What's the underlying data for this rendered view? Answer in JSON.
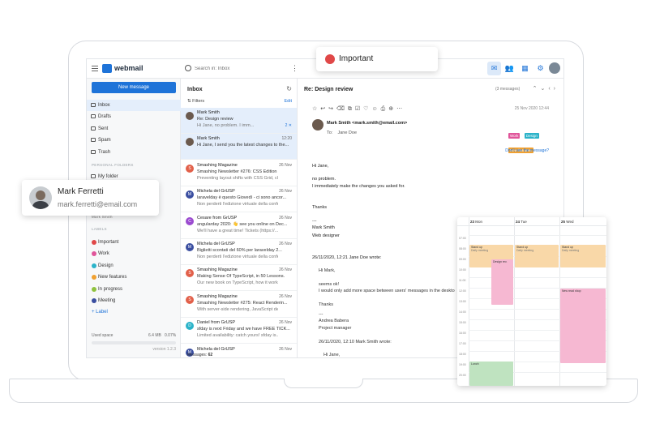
{
  "popups": {
    "important_label": "Important",
    "contact": {
      "first": "Mark",
      "last": "Ferretti",
      "email": "mark.ferretti@email.com"
    }
  },
  "app": {
    "logo": "webmail",
    "search_placeholder": "Search in: Inbox"
  },
  "sidebar": {
    "new_message": "New message",
    "folders": [
      "Inbox",
      "Drafts",
      "Sent",
      "Spam",
      "Trash"
    ],
    "personal_head": "PERSONAL FOLDERS",
    "my_folder": "My folder",
    "contact_sub": "Mark Smith",
    "labels_head": "LABELS",
    "labels": [
      {
        "name": "Important",
        "color": "#e04848"
      },
      {
        "name": "Work",
        "color": "#e0559a"
      },
      {
        "name": "Design",
        "color": "#2bb3c9"
      },
      {
        "name": "New features",
        "color": "#f0a030"
      },
      {
        "name": "In progress",
        "color": "#8fc23e"
      },
      {
        "name": "Meeting",
        "color": "#3a4ea0"
      }
    ],
    "add_label": "+ Label",
    "used_space": "Used space",
    "used_value": "6.4 MB",
    "used_pct": "0.07%",
    "version": "version 1.2.3"
  },
  "list": {
    "title": "Inbox",
    "filters": "Filters",
    "edit": "Edit",
    "footer_label": "Messages:",
    "footer_count": "62",
    "messages": [
      {
        "from": "Mark Smith",
        "date": "",
        "subject": "Re: Design review",
        "preview": "Hi Jane, no problem. I imm...",
        "flag": "2 ✕",
        "av": "#6b5a4e",
        "initial": "",
        "selected": true
      },
      {
        "from": "Mark Smith",
        "date": "12:20",
        "subject": "Hi Jane, I send you the latest changes to the...",
        "preview": "",
        "flag": "",
        "av": "#6b5a4e",
        "initial": "",
        "selected": true
      },
      {
        "from": "Smashing Magazine",
        "date": "26 Nov",
        "subject": "Smashing Newsletter #276: CSS Edition",
        "preview": "Preventing layout shifts with CSS Grid, cla...",
        "flag": "",
        "av": "#e2604a",
        "initial": "S",
        "selected": false
      },
      {
        "from": "Michela del GrUSP",
        "date": "26 Nov",
        "subject": "laravelday è questo Giovedì - ci sono ancor...",
        "preview": "Non perderti l'edizione virtuale della confe...",
        "flag": "",
        "av": "#3a4ea0",
        "initial": "M",
        "selected": false
      },
      {
        "from": "Cesare from GrUSP",
        "date": "26 Nov",
        "subject": "angularday 2020: 👋 see you online on Dec...",
        "preview": "We'll have a great time! Tickets (https://...",
        "flag": "",
        "av": "#9b4bd0",
        "initial": "C",
        "selected": false
      },
      {
        "from": "Michela del GrUSP",
        "date": "26 Nov",
        "subject": "Biglietti scontati del 60% per laravelday 2...",
        "preview": "Non perderti l'edizione virtuale della confe...",
        "flag": "",
        "av": "#3a4ea0",
        "initial": "M",
        "selected": false
      },
      {
        "from": "Smashing Magazine",
        "date": "26 Nov",
        "subject": "Making Sense Of TypeScript, in 50 Lessons.",
        "preview": "Our new book on TypeScript, how it works...",
        "flag": "",
        "av": "#e2604a",
        "initial": "S",
        "selected": false
      },
      {
        "from": "Smashing Magazine",
        "date": "26 Nov",
        "subject": "Smashing Newsletter #275: React Renderin...",
        "preview": "With server-side rendering, JavaScript deb...",
        "flag": "",
        "av": "#e2604a",
        "initial": "S",
        "selected": false
      },
      {
        "from": "Daniel from GrUSP",
        "date": "26 Nov",
        "subject": "sfday is next Friday and we have FREE TICK...",
        "preview": "Limited availability: catch yours! sfday is...",
        "flag": "",
        "av": "#2bb3c9",
        "initial": "D",
        "selected": false
      },
      {
        "from": "Michela del GrUSP",
        "date": "26 Nov",
        "subject": "",
        "preview": "",
        "flag": "",
        "av": "#3a4ea0",
        "initial": "M",
        "selected": false
      }
    ]
  },
  "reading": {
    "title": "Re: Design review",
    "count": "(3 messages)",
    "date": "25 Nov 2020 12:44",
    "sender": "Mark Smith <mark.smith@email.com>",
    "to_label": "To:",
    "to": "Jane Doe",
    "chips": [
      {
        "name": "Work",
        "color": "#e0559a"
      },
      {
        "name": "Design",
        "color": "#2bb3c9"
      },
      {
        "name": "New features",
        "color": "#f0a030"
      }
    ],
    "dont_see": "Don't see the message?",
    "body": [
      "Hi Jane,",
      "no problem.",
      "I immediately make the changes you asked for.",
      "Thanks",
      "---",
      "Mark Smith",
      "Web designer"
    ],
    "quote1_head": "26/11/2020, 12:21 Jane Doe wrote:",
    "quote1": [
      "Hi Mark,",
      "seems ok!",
      "I would only add more space between users' messages in the deskto",
      "Thanks",
      "---",
      "Andrea Babera",
      "Project manager"
    ],
    "quote2_head": "26/11/2020, 12:10 Mark Smith  wrote:",
    "quote2_line": "Hi Jane,"
  },
  "calendar": {
    "days": [
      {
        "num": "23",
        "name": "Mon"
      },
      {
        "num": "24",
        "name": "Tue"
      },
      {
        "num": "25",
        "name": "Wed"
      }
    ],
    "hours": [
      "07:00",
      "08:00",
      "09:00",
      "10:00",
      "11:00",
      "12:00",
      "13:00",
      "14:00",
      "15:00",
      "16:00",
      "17:00",
      "18:00",
      "19:00",
      "20:00"
    ],
    "events": {
      "stand_mon": "Stand up",
      "stand_tue": "Stand up",
      "stand_wed": "Stand up",
      "design": "Design rev.",
      "newread": "New read shop",
      "lunch": "Lunch",
      "sub": "Daily meeting"
    }
  }
}
